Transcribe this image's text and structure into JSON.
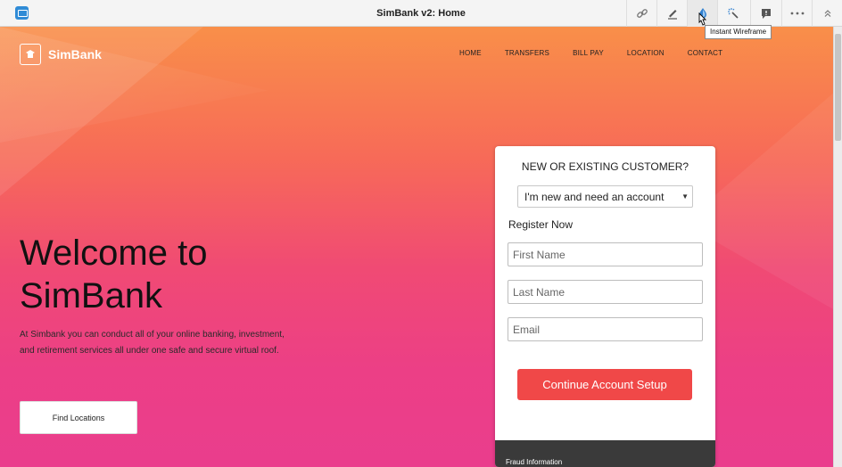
{
  "viewer": {
    "title": "SimBank v2: Home",
    "app_icon": "screen-icon",
    "tools": [
      {
        "name": "link-icon",
        "glyph": "link"
      },
      {
        "name": "pen-icon",
        "glyph": "pen"
      },
      {
        "name": "wireframe-drop-icon",
        "glyph": "drop"
      },
      {
        "name": "magic-wand-icon",
        "glyph": "wand"
      },
      {
        "name": "comment-icon",
        "glyph": "comment"
      },
      {
        "name": "more-icon",
        "glyph": "more"
      },
      {
        "name": "collapse-icon",
        "glyph": "chevron-up"
      }
    ],
    "tooltip": "Instant Wireframe"
  },
  "site": {
    "brand": "SimBank",
    "nav": [
      "HOME",
      "TRANSFERS",
      "BILL PAY",
      "LOCATION",
      "CONTACT"
    ],
    "hero": {
      "title_line1": "Welcome to",
      "title_line2": "SimBank",
      "text": "At Simbank you can conduct all of your online banking, investment, and retirement services all under one safe and secure virtual roof.",
      "button": "Find Locations"
    },
    "form": {
      "heading": "NEW OR EXISTING CUSTOMER?",
      "select_value": "I'm new and need an account",
      "register_label": "Register Now",
      "first_name_placeholder": "First Name",
      "last_name_placeholder": "Last Name",
      "email_placeholder": "Email",
      "submit": "Continue Account Setup",
      "footer": "Fraud Information"
    }
  },
  "colors": {
    "accent": "#f04848",
    "toolbar_bg": "#f4f4f4",
    "gradient_top": "#f98f49",
    "gradient_bottom": "#ea3d8d"
  }
}
